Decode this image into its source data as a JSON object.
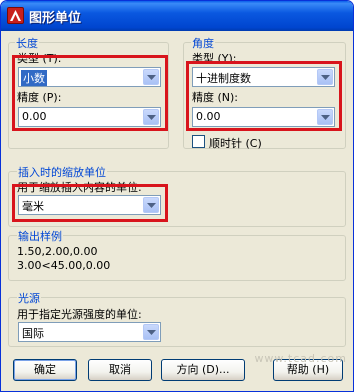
{
  "window": {
    "title": "图形单位",
    "icon": "autocad-app-icon"
  },
  "length": {
    "group_title": "长度",
    "type_label": "类型 (T):",
    "type_value": "小数",
    "precision_label": "精度 (P):",
    "precision_value": "0.00"
  },
  "angle": {
    "group_title": "角度",
    "type_label": "类型 (Y):",
    "type_value": "十进制度数",
    "precision_label": "精度 (N):",
    "precision_value": "0.00",
    "clockwise_label": "顺时针 (C)",
    "clockwise_checked": false
  },
  "insert_scale": {
    "group_title": "插入时的缩放单位",
    "label": "用于缩放插入内容的单位:",
    "value": "毫米"
  },
  "sample_output": {
    "group_title": "输出样例",
    "lines": [
      "1.50,2.00,0.00",
      "3.00<45.00,0.00"
    ]
  },
  "lighting": {
    "group_title": "光源",
    "label": "用于指定光源强度的单位:",
    "value": "国际"
  },
  "buttons": {
    "ok": "确定",
    "cancel": "取消",
    "direction": "方向 (D)...",
    "help": "帮助 (H)"
  },
  "watermark": "www.tcad.com",
  "colors": {
    "highlight_box": "#d8141c",
    "group_title": "#0046d5",
    "selection": "#316ac5",
    "titlebar": "#0a58e0"
  }
}
